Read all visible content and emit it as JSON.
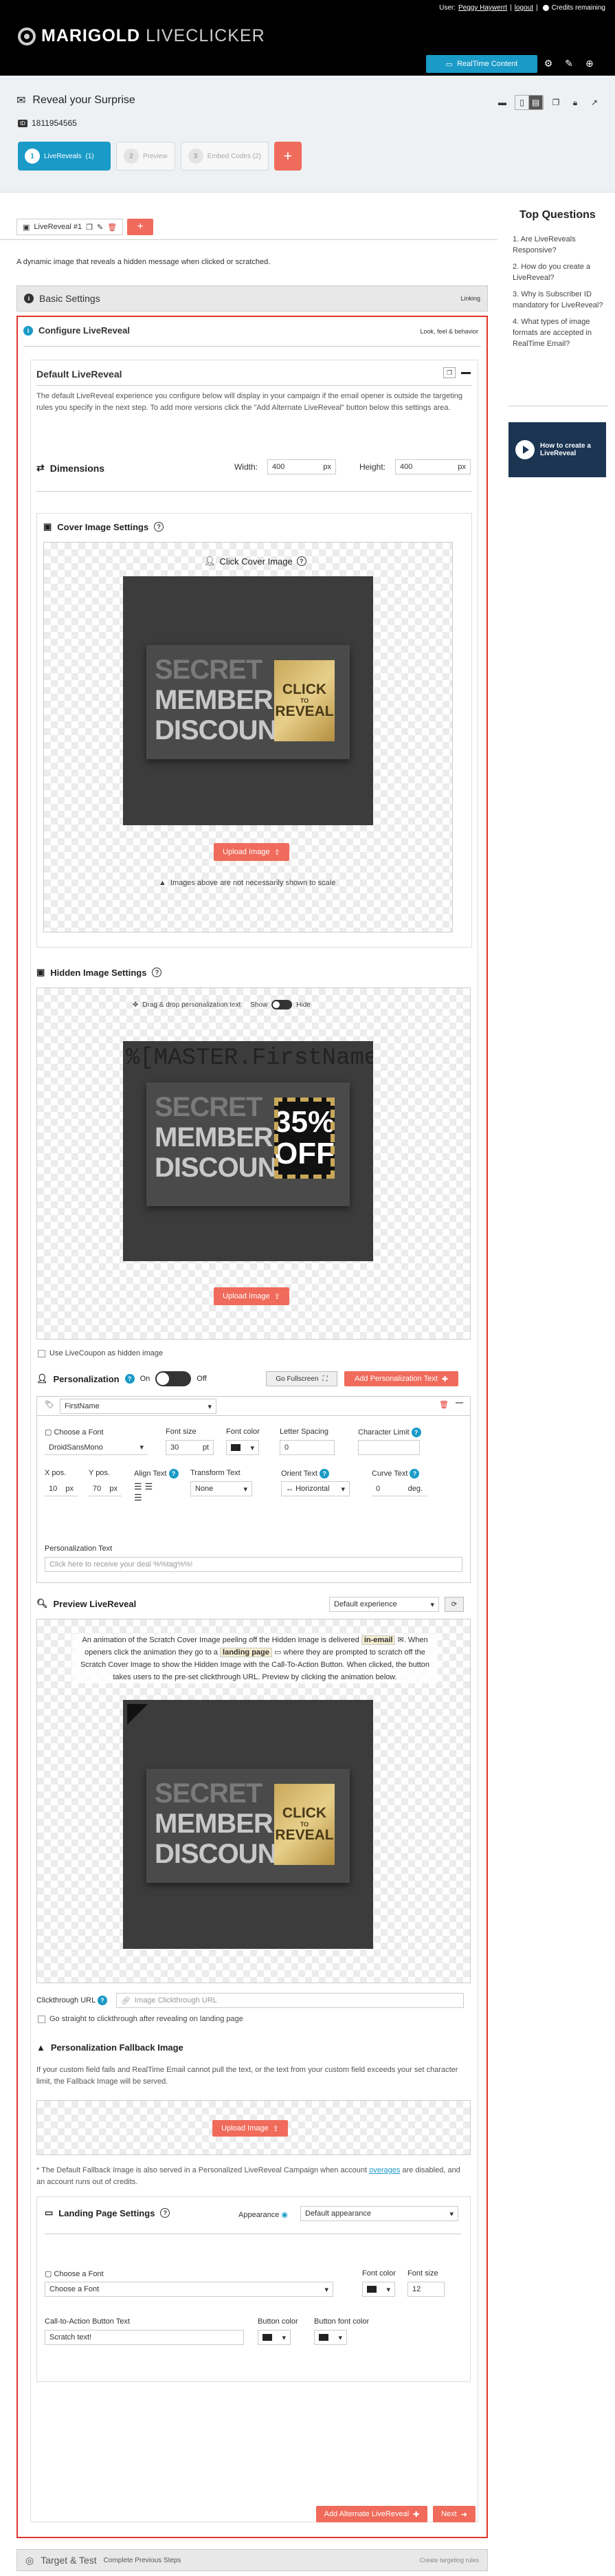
{
  "header": {
    "logo_bold": "MARIGOLD",
    "logo_thin": "LIVECLICKER",
    "user_prefix": "User:",
    "user_name": "Peggy Haywerrt",
    "logout": "logout",
    "credits_text": "Credits remaining",
    "realtime_button": "RealTime Content"
  },
  "page": {
    "title": "Reveal your Surprise",
    "id_badge": "ID",
    "id": "1811954565"
  },
  "steps": [
    {
      "num": "1",
      "label": "LiveReveals",
      "extra": "(1)"
    },
    {
      "num": "2",
      "label": "Preview"
    },
    {
      "num": "3",
      "label": "Embed Codes (2)"
    }
  ],
  "tab": {
    "label": "LiveReveal #1"
  },
  "description": "A dynamic image that reveals a hidden message when clicked or scratched.",
  "basic_settings": {
    "title": "Basic Settings",
    "right": "Linking"
  },
  "configure": {
    "title": "Configure LiveReveal",
    "right": "Look, feel & behavior",
    "default_title": "Default LiveReveal",
    "default_desc": "The default LiveReveal experience you configure below will display in your campaign if the email opener is outside the targeting rules you specify in the next step. To add more versions click the \"Add Alternate LiveReveal\" button below this settings area."
  },
  "dimensions": {
    "title": "Dimensions",
    "width_label": "Width:",
    "width_value": "400",
    "width_unit": "px",
    "height_label": "Height:",
    "height_value": "400",
    "height_unit": "px"
  },
  "cover": {
    "title": "Cover Image Settings",
    "click_label": "Click Cover Image",
    "upload": "Upload Image",
    "scale_note": "Images above are not necessarily shown to scale"
  },
  "card": {
    "line1": "SECRET",
    "line2": "MEMBER",
    "line3": "DISCOUNT",
    "gold_top": "CLICK",
    "gold_mid": "TO",
    "gold_bottom": "REVEAL",
    "hidden_top": "35%",
    "hidden_bottom": "OFF"
  },
  "hidden": {
    "title": "Hidden Image Settings",
    "drag_label": "Drag & drop personalization text",
    "show": "Show",
    "hide": "Hide",
    "tag": "%[MASTER.FirstName]",
    "upload": "Upload Image",
    "coupon_label": "Use LiveCoupon as hidden image"
  },
  "personalization": {
    "title": "Personalization",
    "on": "On",
    "off": "Off",
    "fullscreen": "Go Fullscreen",
    "add_text": "Add Personalization Text",
    "field_value": "FirstName",
    "font_label": "Choose a Font",
    "font_value": "DroidSansMono",
    "size_label": "Font size",
    "size_value": "30",
    "size_unit": "pt",
    "color_label": "Font color",
    "spacing_label": "Letter Spacing",
    "spacing_value": "0",
    "limit_label": "Character Limit",
    "xpos_label": "X pos.",
    "xpos_value": "10",
    "xpos_unit": "px",
    "ypos_label": "Y pos.",
    "ypos_value": "70",
    "ypos_unit": "px",
    "align_label": "Align Text",
    "transform_label": "Transform Text",
    "transform_value": "None",
    "orient_label": "Orient Text",
    "orient_value": "Horizontal",
    "curve_label": "Curve Text",
    "curve_value": "0",
    "curve_unit": "deg.",
    "ptext_label": "Personalization Text",
    "ptext_placeholder": "Click here to receive your deal %%tag%%!"
  },
  "preview": {
    "title": "Preview LiveReveal",
    "select": "Default experience",
    "desc_1": "An animation of the Scratch Cover Image peeling off the Hidden Image is delivered",
    "desc_hl1": "in-email",
    "desc_2": ". When openers click the animation they go to a",
    "desc_hl2": "landing page",
    "desc_3": "where they are prompted to scratch off the Scratch Cover Image to show the Hidden Image with the Call-To-Action Button. When clicked, the button takes users to the pre-set clickthrough URL. Preview by clicking the animation below."
  },
  "clickthrough": {
    "label": "Clickthrough URL",
    "placeholder": "Image Clickthrough URL",
    "checkbox": "Go straight to clickthrough after revealing on landing page"
  },
  "fallback": {
    "title": "Personalization Fallback Image",
    "desc": "If your custom field fails and RealTime Email cannot pull the text, or the text from your custom field exceeds your set character limit, the Fallback Image will be served.",
    "upload": "Upload Image",
    "note_1": "* The Default Fallback Image is also served in a Personalized LiveReveal Campaign when account",
    "note_link": "overages",
    "note_2": "are disabled, and an account runs out of credits."
  },
  "landing": {
    "title": "Landing Page Settings",
    "appearance_label": "Appearance",
    "appearance_value": "Default appearance",
    "font_label": "Choose a Font",
    "font_value": "Choose a Font",
    "color_label": "Font color",
    "size_label": "Font size",
    "size_value": "12",
    "cta_label": "Call-to-Action Button Text",
    "cta_value": "Scratch text!",
    "btn_color_label": "Button color",
    "btn_font_color_label": "Button font color"
  },
  "bottom": {
    "add_alt": "Add Alternate LiveReveal",
    "next": "Next"
  },
  "target": {
    "title": "Target & Test",
    "sub": "Complete Previous Steps",
    "right": "Create targeting rules"
  },
  "sidebar": {
    "title": "Top Questions",
    "items": [
      "Are LiveReveals Responsive?",
      "How do you create a LiveReveal?",
      "Why is Subscriber ID mandatory for LiveReveal?",
      "What types of image formats are accepted in RealTime Email?"
    ],
    "video_label": "How to create a LiveReveal"
  },
  "colors": {
    "accent_blue": "#1a9ac7",
    "action_red": "#f06b5b",
    "border_red": "#e2342b"
  }
}
